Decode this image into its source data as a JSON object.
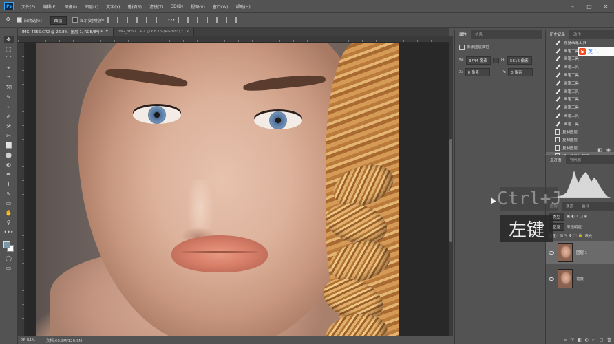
{
  "app": {
    "logo": "Ps"
  },
  "menubar": {
    "items": [
      "文件(F)",
      "编辑(E)",
      "图像(I)",
      "图层(L)",
      "文字(Y)",
      "选择(S)",
      "滤镜(T)",
      "3D(D)",
      "视图(V)",
      "窗口(W)",
      "帮助(H)"
    ],
    "window_controls": [
      "–",
      "□",
      "✕"
    ]
  },
  "options": {
    "auto_select_label": "自动选择：",
    "auto_select_value": "图层",
    "show_transform_label": "显示变换控件",
    "more": "•••"
  },
  "tabs": [
    {
      "label": "IMG_4655.CR2 @ 26.8% (图层 1, RGB/8*) *",
      "close": "×"
    },
    {
      "label": "IMG_8657.CR2 @ 68.1%(RGB/8*) *",
      "close": "×"
    }
  ],
  "toolbar": {
    "tools": [
      "✥",
      "⬚",
      "⌒",
      "⌖",
      "⌗",
      "⌧",
      "✎",
      "⌁",
      "✐",
      "⚒",
      "✂",
      "⬜",
      "⬤",
      "◐",
      "✒",
      "T",
      "↖",
      "▭",
      "✋",
      "⚲",
      "•••"
    ]
  },
  "status": {
    "zoom": "26.84%",
    "doc": "文档:60.3M/120.3M"
  },
  "properties": {
    "tabs": [
      "属性",
      "信息"
    ],
    "section": "像素图层属性",
    "w_label": "W:",
    "w_value": "3744 像素",
    "h_label": "H:",
    "h_value": "5616 像素",
    "x_label": "X:",
    "x_value": "0 像素",
    "y_label": "Y:",
    "y_value": "0 像素"
  },
  "history": {
    "tabs": [
      "历史记录",
      "动作"
    ],
    "items": [
      "修复画笔工具",
      "画笔工具",
      "画笔工具",
      "画笔工具",
      "画笔工具",
      "画笔工具",
      "画笔工具",
      "画笔工具",
      "画笔工具",
      "画笔工具",
      "画笔工具",
      "复制图层",
      "复制图层",
      "复制图层",
      "通过拷贝的图层"
    ],
    "item_types": [
      "brush",
      "brush",
      "brush",
      "brush",
      "brush",
      "brush",
      "brush",
      "brush",
      "brush",
      "brush",
      "brush",
      "doc",
      "doc",
      "doc",
      "doc"
    ],
    "ime_logo": "S",
    "ime_mode": "英 ˙,"
  },
  "histogram": {
    "tabs": [
      "直方图",
      "导航器"
    ]
  },
  "layers": {
    "tabs": [
      "图层",
      "通道",
      "路径"
    ],
    "kind_filter": "类型",
    "blend_mode": "正常",
    "opacity_label": "不透明度:",
    "lock_label": "锁定:",
    "fill_label": "填充:",
    "list": [
      {
        "name": "图层 1",
        "selected": true
      },
      {
        "name": "背景",
        "selected": false
      }
    ],
    "footer_icons": [
      "fx",
      "◧",
      "◐",
      "▭",
      "▢",
      "🗑"
    ]
  },
  "overlay": {
    "key_hint": "Ctrl+J",
    "mouse_hint": "左键"
  },
  "colors": {
    "fg": "#7b98a8",
    "bg": "#ffffff",
    "ps_blue": "#31a8ff"
  }
}
